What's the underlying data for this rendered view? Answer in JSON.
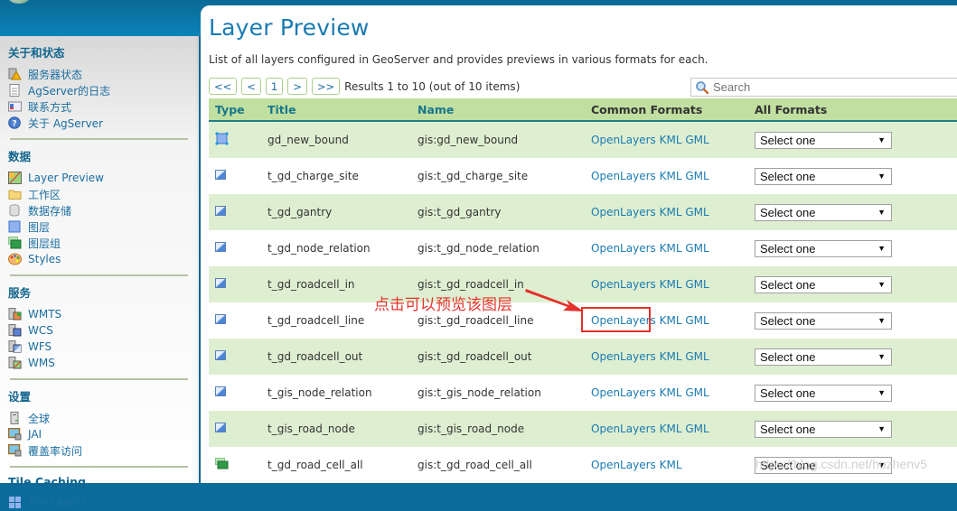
{
  "sidebar": {
    "sections": [
      {
        "heading": "关于和状态",
        "items": [
          {
            "label": "服务器状态",
            "icon": "server-status-icon"
          },
          {
            "label": "AgServer的日志",
            "icon": "log-document-icon"
          },
          {
            "label": "联系方式",
            "icon": "contact-card-icon"
          },
          {
            "label": "关于 AgServer",
            "icon": "help-icon"
          }
        ]
      },
      {
        "heading": "数据",
        "items": [
          {
            "label": "Layer Preview",
            "icon": "layer-preview-icon"
          },
          {
            "label": "工作区",
            "icon": "folder-icon"
          },
          {
            "label": "数据存储",
            "icon": "database-icon"
          },
          {
            "label": "图层",
            "icon": "layer-icon"
          },
          {
            "label": "图层组",
            "icon": "layer-group-icon"
          },
          {
            "label": "Styles",
            "icon": "palette-icon"
          }
        ]
      },
      {
        "heading": "服务",
        "items": [
          {
            "label": "WMTS",
            "icon": "wmts-service-icon"
          },
          {
            "label": "WCS",
            "icon": "wcs-service-icon"
          },
          {
            "label": "WFS",
            "icon": "wfs-service-icon"
          },
          {
            "label": "WMS",
            "icon": "wms-service-icon"
          }
        ]
      },
      {
        "heading": "设置",
        "items": [
          {
            "label": "全球",
            "icon": "global-settings-icon"
          },
          {
            "label": "JAI",
            "icon": "jai-icon"
          },
          {
            "label": "覆盖率访问",
            "icon": "coverage-access-icon"
          }
        ]
      },
      {
        "heading": "Tile Caching",
        "items": [
          {
            "label": "Tile Layers",
            "icon": "tile-layers-icon"
          }
        ]
      }
    ]
  },
  "page": {
    "title": "Layer Preview",
    "description": "List of all layers configured in GeoServer and provides previews in various formats for each."
  },
  "pager": {
    "first": "<<",
    "prev": "<",
    "page": "1",
    "next": ">",
    "last": ">>",
    "results": "Results 1 to 10 (out of 10 items)"
  },
  "search": {
    "placeholder": "Search",
    "value": ""
  },
  "table": {
    "headers": {
      "type": "Type",
      "title": "Title",
      "name": "Name",
      "common": "Common Formats",
      "all": "All Formats"
    },
    "rows": [
      {
        "type": "polygon",
        "title": "gd_new_bound",
        "name": "gis:gd_new_bound",
        "formats": [
          "OpenLayers",
          "KML",
          "GML"
        ],
        "select": "Select one"
      },
      {
        "type": "raster",
        "title": "t_gd_charge_site",
        "name": "gis:t_gd_charge_site",
        "formats": [
          "OpenLayers",
          "KML",
          "GML"
        ],
        "select": "Select one"
      },
      {
        "type": "raster",
        "title": "t_gd_gantry",
        "name": "gis:t_gd_gantry",
        "formats": [
          "OpenLayers",
          "KML",
          "GML"
        ],
        "select": "Select one"
      },
      {
        "type": "raster",
        "title": "t_gd_node_relation",
        "name": "gis:t_gd_node_relation",
        "formats": [
          "OpenLayers",
          "KML",
          "GML"
        ],
        "select": "Select one"
      },
      {
        "type": "raster",
        "title": "t_gd_roadcell_in",
        "name": "gis:t_gd_roadcell_in",
        "formats": [
          "OpenLayers",
          "KML",
          "GML"
        ],
        "select": "Select one"
      },
      {
        "type": "raster",
        "title": "t_gd_roadcell_line",
        "name": "gis:t_gd_roadcell_line",
        "formats": [
          "OpenLayers",
          "KML",
          "GML"
        ],
        "select": "Select one"
      },
      {
        "type": "raster",
        "title": "t_gd_roadcell_out",
        "name": "gis:t_gd_roadcell_out",
        "formats": [
          "OpenLayers",
          "KML",
          "GML"
        ],
        "select": "Select one"
      },
      {
        "type": "raster",
        "title": "t_gis_node_relation",
        "name": "gis:t_gis_node_relation",
        "formats": [
          "OpenLayers",
          "KML",
          "GML"
        ],
        "select": "Select one"
      },
      {
        "type": "raster",
        "title": "t_gis_road_node",
        "name": "gis:t_gis_road_node",
        "formats": [
          "OpenLayers",
          "KML",
          "GML"
        ],
        "select": "Select one"
      },
      {
        "type": "group",
        "title": "t_gd_road_cell_all",
        "name": "gis:t_gd_road_cell_all",
        "formats": [
          "OpenLayers",
          "KML"
        ],
        "select": "Select one"
      }
    ]
  },
  "annotation": {
    "text": "点击可以预览该图层",
    "color": "#e5312b"
  },
  "watermark": "https://blog.csdn.net/huzhenv5"
}
